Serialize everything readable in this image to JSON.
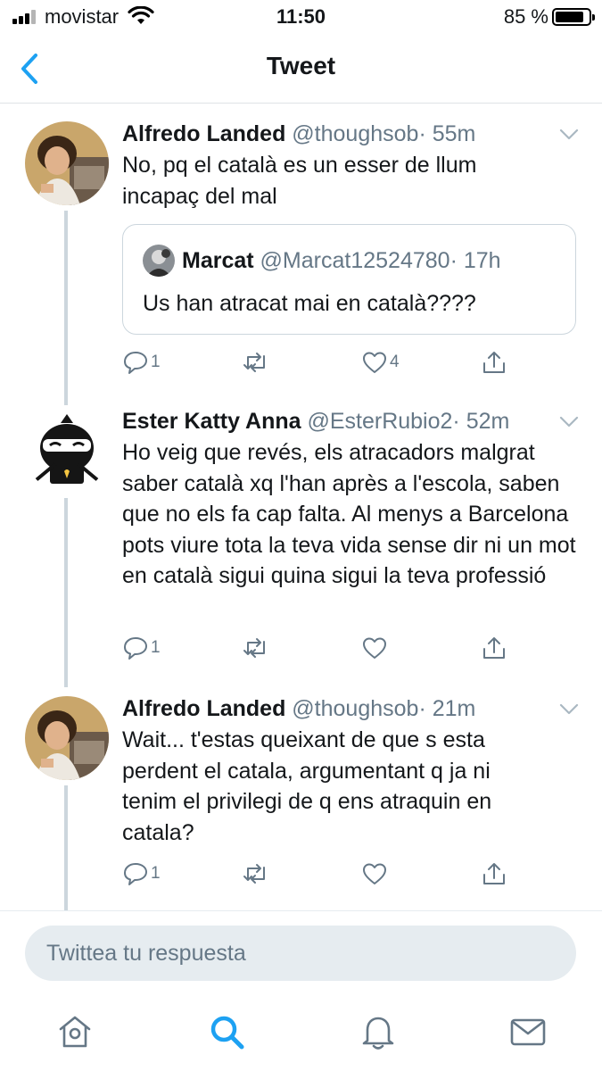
{
  "status_bar": {
    "carrier": "movistar",
    "time": "11:50",
    "battery_percent": "85 %",
    "battery_level": 0.85,
    "icons": [
      "signal-icon",
      "wifi-icon",
      "battery-icon"
    ]
  },
  "nav": {
    "title": "Tweet",
    "back_icon": "chevron-left-icon"
  },
  "tweets": [
    {
      "name": "Alfredo Landed",
      "handle": "@thoughsob",
      "time": "· 55m",
      "text": "No, pq el català es un esser de llum incapaç del mal",
      "quote": {
        "name": "Marcat",
        "handle": "@Marcat12524780",
        "time": "· 17h",
        "text": "Us han atracat mai en català????"
      },
      "reply_count": "1",
      "retweet_count": "",
      "like_count": "4"
    },
    {
      "name": "Ester Katty Anna",
      "handle": "@EsterRubio2",
      "time": "· 52m",
      "text": "Ho veig que revés, els atracadors malgrat saber català xq l'han après a l'escola, saben que no els fa cap falta. Al menys a Barcelona pots viure tota la teva vida sense dir ni un mot en català sigui quina sigui la teva professió",
      "reply_count": "1",
      "retweet_count": "",
      "like_count": ""
    },
    {
      "name": "Alfredo Landed",
      "handle": "@thoughsob",
      "time": "· 21m",
      "text": "Wait... t'estas queixant de que s esta perdent el catala, argumentant q ja ni tenim el privilegi de q ens atraquin en catala?",
      "reply_count": "1",
      "retweet_count": "",
      "like_count": ""
    }
  ],
  "reply": {
    "placeholder": "Twittea tu respuesta"
  },
  "tabs": [
    "home-icon",
    "search-icon",
    "notifications-icon",
    "messages-icon"
  ],
  "colors": {
    "accent": "#1da1f2",
    "secondary_text": "#657786",
    "border": "#ccd6dd"
  }
}
